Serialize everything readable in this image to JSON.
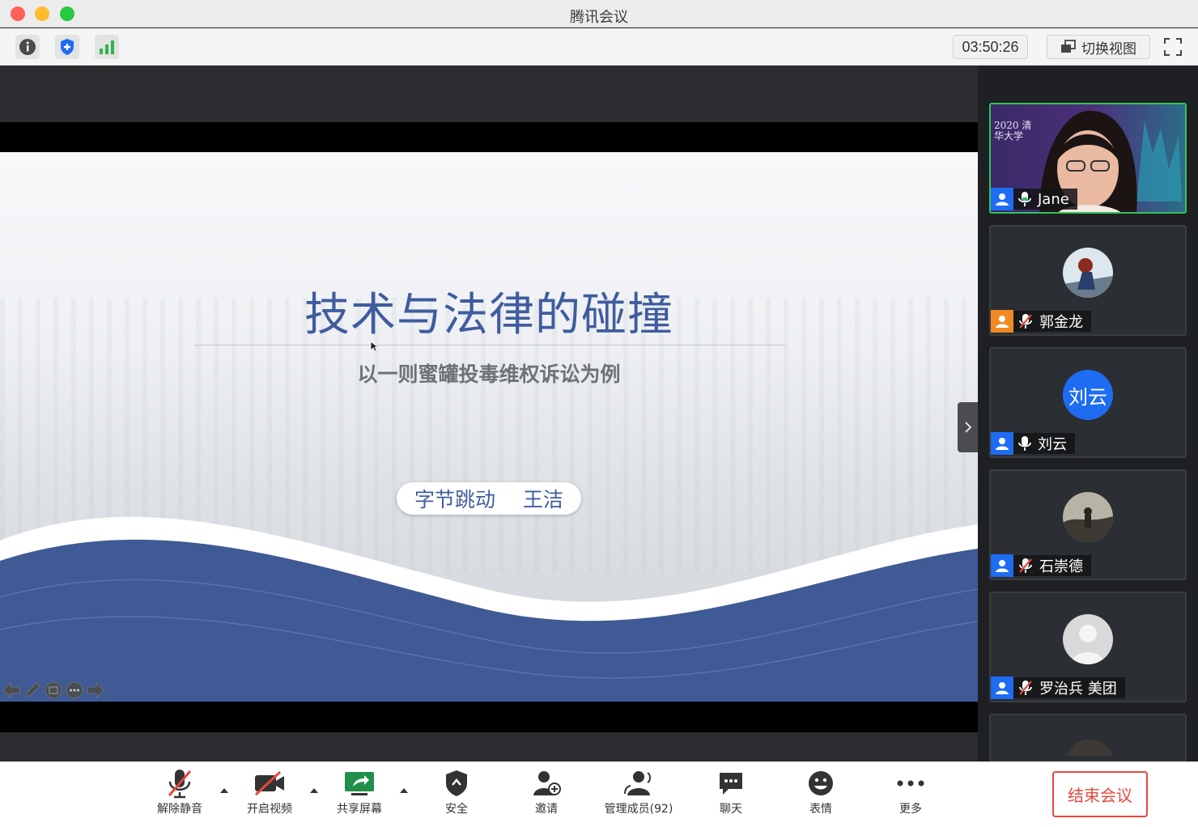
{
  "window": {
    "title": "腾讯会议"
  },
  "toolbar": {
    "icons": [
      "info-icon",
      "shield-icon",
      "signal-icon"
    ],
    "timer": "03:50:26",
    "switch_view_label": "切换视图"
  },
  "slide": {
    "title": "技术与法律的碰撞",
    "subtitle": "以一则蜜罐投毒维权诉讼为例",
    "company": "字节跳动",
    "presenter": "王洁",
    "colors": {
      "title": "#3f5c9e",
      "wave": "#3f5a95"
    }
  },
  "participants": [
    {
      "name": "Jane",
      "mic": "on",
      "video": true,
      "active": true,
      "backdrop_text": "2020 清华大学"
    },
    {
      "name": "郭金龙",
      "mic": "muted",
      "video": false
    },
    {
      "name": "刘云",
      "mic": "on",
      "video": false,
      "avatar_text": "刘云"
    },
    {
      "name": "石崇德",
      "mic": "muted",
      "video": false
    },
    {
      "name": "罗治兵 美团",
      "mic": "muted",
      "video": false
    }
  ],
  "bottombar": {
    "unmute": "解除静音",
    "start_video": "开启视频",
    "share_screen": "共享屏幕",
    "security": "安全",
    "invite": "邀请",
    "manage_members": "管理成员(92)",
    "chat": "聊天",
    "reactions": "表情",
    "more": "更多",
    "end_meeting": "结束会议"
  },
  "colors": {
    "accent_green": "#36c25b",
    "end_red": "#e7473c",
    "avatar_blue": "#1d6cf2"
  }
}
